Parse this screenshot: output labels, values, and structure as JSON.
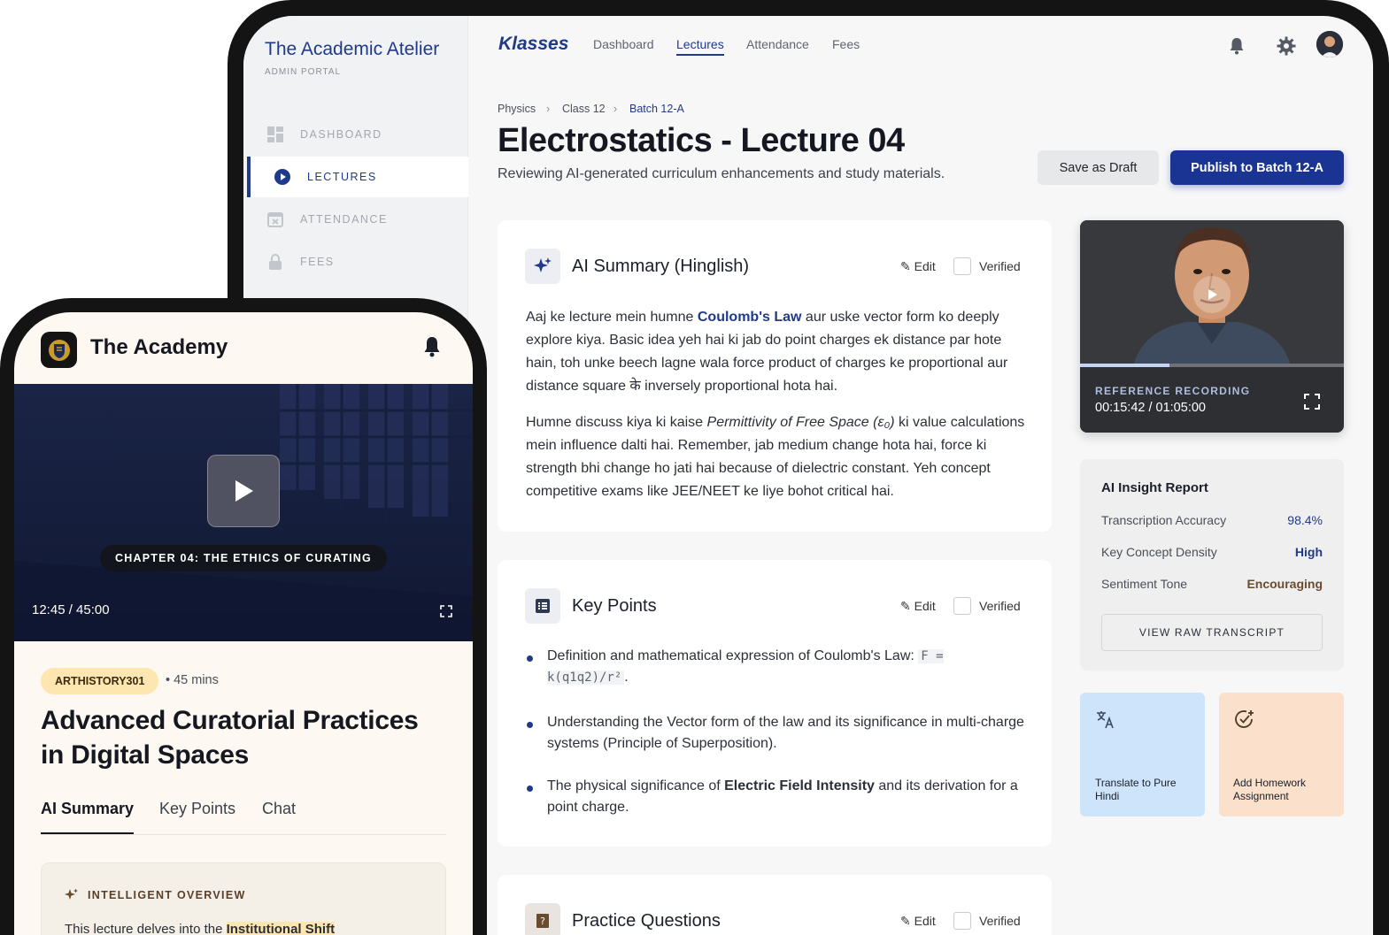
{
  "tablet": {
    "sidebar": {
      "brand": "The Academic Atelier",
      "brand_sub": "ADMIN PORTAL",
      "items": [
        {
          "label": "DASHBOARD"
        },
        {
          "label": "LECTURES"
        },
        {
          "label": "ATTENDANCE"
        },
        {
          "label": "FEES"
        }
      ]
    },
    "topbar": {
      "logo": "Klasses",
      "nav": [
        "Dashboard",
        "Lectures",
        "Attendance",
        "Fees"
      ]
    },
    "breadcrumb": [
      "Physics",
      "Class 12",
      "Batch 12-A"
    ],
    "title": "Electrostatics - Lecture 04",
    "subtitle": "Reviewing AI-generated curriculum enhancements and study materials.",
    "save_draft": "Save as Draft",
    "publish": "Publish to Batch 12-A",
    "edit_label": "Edit",
    "verified_label": "Verified",
    "summary": {
      "title": "AI Summary (Hinglish)",
      "p1_a": "Aaj ke lecture mein humne ",
      "p1_link": "Coulomb's Law",
      "p1_b": " aur uske vector form ko deeply explore kiya. Basic idea yeh hai ki jab do point charges ek distance par hote hain, toh unke beech lagne wala force product of charges ke proportional aur distance square के inversely proportional hota hai.",
      "p2_a": "Humne discuss kiya ki kaise ",
      "p2_em": "Permittivity of Free Space (ε₀)",
      "p2_b": " ki value calculations mein influence dalti hai. Remember, jab medium change hota hai, force ki strength bhi change ho jati hai because of dielectric constant. Yeh concept competitive exams like JEE/NEET ke liye bohot critical hai."
    },
    "key_points": {
      "title": "Key Points",
      "items": [
        {
          "a": "Definition and mathematical expression of Coulomb's Law: ",
          "code": "F = k(q1q2)/r²",
          "b": "."
        },
        {
          "a": "Understanding the Vector form of the law and its significance in multi-charge systems (Principle of Superposition).",
          "bold": "",
          "b": ""
        },
        {
          "a": "The physical significance of ",
          "bold": "Electric Field Intensity",
          "b": " and its derivation for a point charge."
        }
      ]
    },
    "practice": {
      "title": "Practice Questions"
    },
    "video": {
      "label": "REFERENCE RECORDING",
      "time": "00:15:42 / 01:05:00",
      "progress": 0.34
    },
    "insight": {
      "title": "AI Insight Report",
      "rows": [
        {
          "label": "Transcription Accuracy",
          "value": "98.4%"
        },
        {
          "label": "Key Concept Density",
          "value": "High"
        },
        {
          "label": "Sentiment Tone",
          "value": "Encouraging"
        }
      ],
      "button": "VIEW RAW TRANSCRIPT"
    },
    "tiles": [
      {
        "label": "Translate to Pure Hindi",
        "color": "#cde4fb"
      },
      {
        "label": "Add Homework Assignment",
        "color": "#fbe0cb"
      }
    ]
  },
  "phone": {
    "app_title": "The Academy",
    "video": {
      "chapter": "CHAPTER 04: THE ETHICS OF CURATING",
      "time": "12:45 / 45:00"
    },
    "course_tag": "ARTHISTORY301",
    "duration": "• 45 mins",
    "title": "Advanced Curatorial Practices in Digital Spaces",
    "tabs": [
      "AI Summary",
      "Key Points",
      "Chat"
    ],
    "overview_label": "INTELLIGENT OVERVIEW",
    "overview_text_a": "This lecture delves into the ",
    "overview_text_b": "Institutional Shift"
  },
  "colors": {
    "accent": "#1f3a8a",
    "publish": "#1a3494",
    "tag": "#fde6b0"
  }
}
